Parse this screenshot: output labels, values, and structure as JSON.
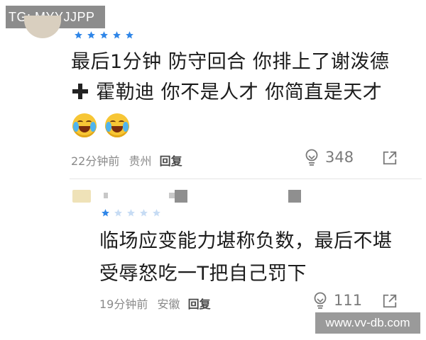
{
  "watermark": {
    "top_left": "TG: MYYJJPP",
    "bottom_right": "www.vv-db.com"
  },
  "comments": [
    {
      "rating": 5,
      "lines": [
        "最后1分钟 防守回合 你排上了谢泼德",
        "霍勒迪 你不是人才 你简直是天才"
      ],
      "line2_prefix_icon": "heavy-plus-icon",
      "emojis": [
        "laughing-crying-face-icon",
        "laughing-crying-face-icon"
      ],
      "time": "22分钟前",
      "location": "贵州",
      "reply_label": "回复",
      "likes": "348"
    },
    {
      "rating": 1,
      "lines": [
        "临场应变能力堪称负数，最后不堪",
        "受辱怒吃一T把自己罚下"
      ],
      "time": "19分钟前",
      "location": "安徽",
      "reply_label": "回复",
      "likes": "111"
    }
  ],
  "colors": {
    "star": "#2f86e8",
    "star_empty": "#c7dcf4",
    "meta": "#8a8a8a",
    "text": "#1c1c1c"
  }
}
